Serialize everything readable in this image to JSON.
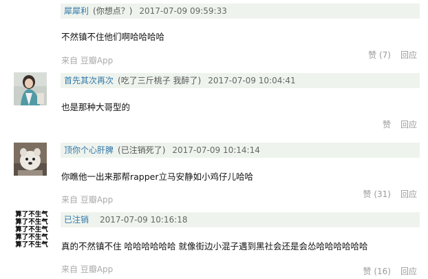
{
  "comments": [
    {
      "username": "犀犀利",
      "sig": "(你想点？)",
      "time": "2017-07-09 09:59:33",
      "content": "不然镇不住他们啊哈哈哈哈",
      "source": "来自 豆瓣App",
      "like": "赞 (7)",
      "reply": "回应"
    },
    {
      "username": "首先其次再次",
      "sig": "(吃了三斤桃子 我醉了)",
      "time": "2017-07-09 10:04:41",
      "content": "也是那种大哥型的",
      "like": "赞",
      "reply": "回应"
    },
    {
      "username": "顶你个心肝脾",
      "sig": "(已注销死了)",
      "time": "2017-07-09 10:14:14",
      "content": "你瞧他一出来那帮rapper立马安静如小鸡仔儿哈哈",
      "source": "来自 豆瓣App",
      "like": "赞 (31)",
      "reply": "回应"
    },
    {
      "username": "已注销",
      "time": "2017-07-09 10:16:18",
      "content": "真的不然镇不住 哈哈哈哈哈哈 就像街边小混子遇到黑社会还是会怂哈哈哈哈哈哈",
      "source": "来自 豆瓣App",
      "like": "赞 (16)",
      "reply": "回应",
      "avatar_text": [
        "算了不生气",
        "算了不生气",
        "算了不生气",
        "算了不生气",
        "算了不生气"
      ]
    }
  ]
}
